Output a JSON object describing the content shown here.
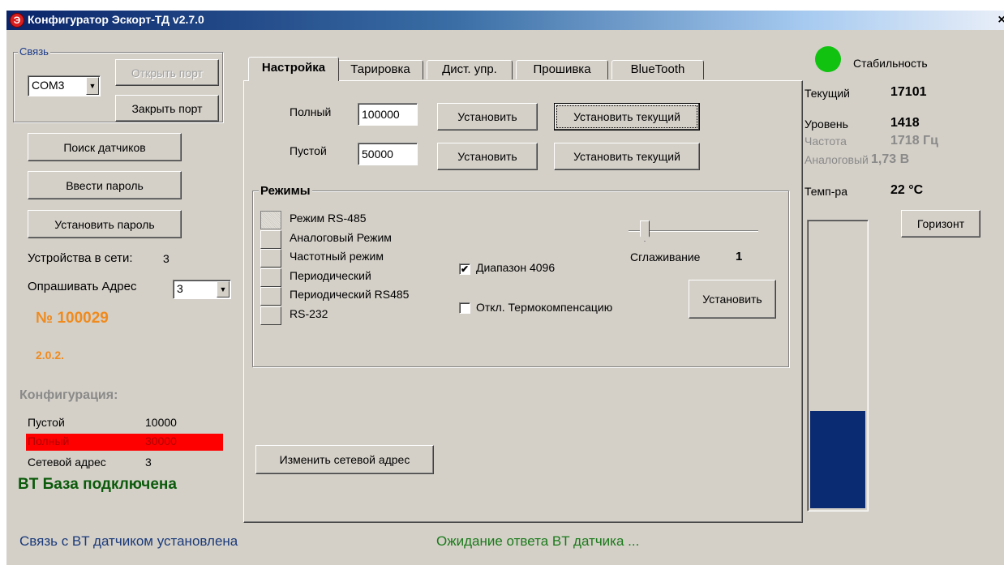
{
  "window": {
    "title": "Конфигуратор Эскорт-ТД v2.7.0",
    "app_icon_letter": "Э",
    "close_glyph": "×"
  },
  "connection": {
    "group_label": "Связь",
    "port_value": "COM3",
    "open_port_label": "Открыть порт",
    "close_port_label": "Закрыть порт"
  },
  "left": {
    "search_sensors_label": "Поиск датчиков",
    "enter_password_label": "Ввести пароль",
    "set_password_label": "Установить пароль",
    "devices_label": "Устройства в сети:",
    "devices_count": "3",
    "poll_address_label": "Опрашивать Адрес",
    "poll_address_value": "3",
    "serial_number": "№ 100029",
    "firmware_version": "2.0.2."
  },
  "config": {
    "title": "Конфигурация:",
    "empty_label": "Пустой",
    "empty_value": "10000",
    "full_label": "Полный",
    "full_value": "30000",
    "net_address_label": "Сетевой адрес",
    "net_address_value": "3",
    "bt_status": "BT База подключена"
  },
  "tabs": [
    {
      "label": "Настройка",
      "active": true
    },
    {
      "label": "Тарировка",
      "active": false
    },
    {
      "label": "Дист. упр.",
      "active": false
    },
    {
      "label": "Прошивка",
      "active": false
    },
    {
      "label": "BlueTooth",
      "active": false
    }
  ],
  "settings": {
    "full_label": "Полный",
    "full_value": "100000",
    "empty_label": "Пустой",
    "empty_value": "50000",
    "set_label": "Установить",
    "set_current_label": "Установить текущий",
    "modes_title": "Режимы",
    "modes": [
      {
        "label": "Режим RS-485",
        "selected": true
      },
      {
        "label": "Аналоговый Режим",
        "selected": false
      },
      {
        "label": "Частотный режим",
        "selected": false
      },
      {
        "label": "Периодический",
        "selected": false
      },
      {
        "label": "Периодический RS485",
        "selected": false
      },
      {
        "label": "RS-232",
        "selected": false
      }
    ],
    "range_checkbox_label": "Диапазон 4096",
    "range_checked": true,
    "thermo_checkbox_label": "Откл. Термокомпенсацию",
    "thermo_checked": false,
    "check_glyph": "✔",
    "smoothing_label": "Сглаживание",
    "smoothing_value": "1",
    "set_mode_label": "Установить",
    "change_address_label": "Изменить сетевой адрес"
  },
  "readings": {
    "stability_label": "Стабильность",
    "stability_color": "#11c211",
    "current_label": "Текущий",
    "current_value": "17101",
    "level_label": "Уровень",
    "level_value": "1418",
    "frequency_label": "Частота",
    "frequency_value": "1718 Гц",
    "analog_label": "Аналоговый",
    "analog_value": "1,73 В",
    "temp_label": "Темп-ра",
    "temp_value": "22 °C",
    "horizon_label": "Горизонт",
    "level_fill_fraction": 0.34,
    "level_fill_color": "#0a2a72"
  },
  "status": {
    "left": "Связь с BT датчиком установлена",
    "right": "Ожидание ответа BT датчика ..."
  },
  "colors": {
    "accent_orange": "#f08a1c",
    "highlight_red": "#ff0000",
    "status_blue": "#1a3a7a",
    "status_green": "#1a7a1a",
    "bt_green": "#0b5a0b"
  }
}
